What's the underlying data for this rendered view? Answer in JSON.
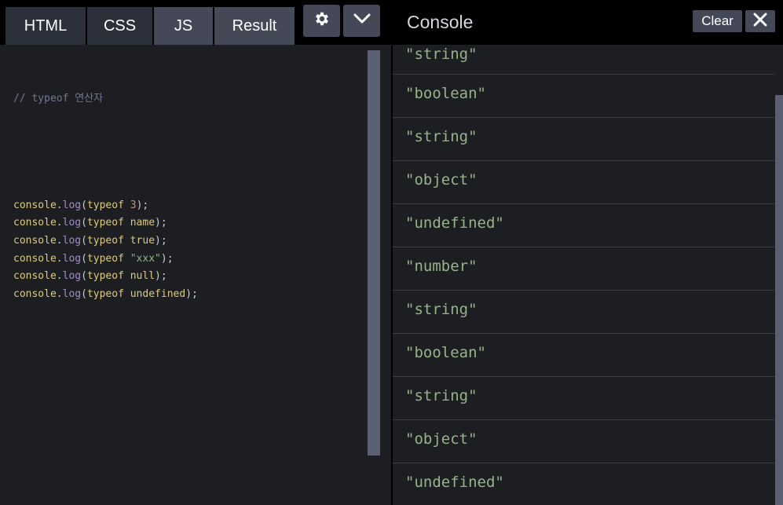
{
  "editor": {
    "tabs": [
      {
        "label": "HTML"
      },
      {
        "label": "CSS"
      },
      {
        "label": "JS"
      },
      {
        "label": "Result"
      }
    ],
    "settings_icon": "gear-icon",
    "collapse_icon": "chevron-down-icon",
    "code": {
      "comment": "// typeof 연산자",
      "lines": [
        {
          "obj": "console",
          "dot": ".",
          "method": "log",
          "open": "(",
          "kw": "typeof",
          "sp": " ",
          "arg": "3",
          "close": ");"
        },
        {
          "obj": "console",
          "dot": ".",
          "method": "log",
          "open": "(",
          "kw": "typeof",
          "sp": " ",
          "arg": "name",
          "close": ");"
        },
        {
          "obj": "console",
          "dot": ".",
          "method": "log",
          "open": "(",
          "kw": "typeof",
          "sp": " ",
          "arg": "true",
          "close": ");"
        },
        {
          "obj": "console",
          "dot": ".",
          "method": "log",
          "open": "(",
          "kw": "typeof",
          "sp": " ",
          "arg": "\"xxx\"",
          "close": ");"
        },
        {
          "obj": "console",
          "dot": ".",
          "method": "log",
          "open": "(",
          "kw": "typeof",
          "sp": " ",
          "arg": "null",
          "close": ");"
        },
        {
          "obj": "console",
          "dot": ".",
          "method": "log",
          "open": "(",
          "kw": "typeof",
          "sp": " ",
          "arg": "undefined",
          "close": ");"
        }
      ]
    }
  },
  "console": {
    "title": "Console",
    "clear_label": "Clear",
    "close_icon": "close-icon",
    "entries": [
      "\"string\"",
      "\"boolean\"",
      "\"string\"",
      "\"object\"",
      "\"undefined\"",
      "\"number\"",
      "\"string\"",
      "\"boolean\"",
      "\"string\"",
      "\"object\"",
      "\"undefined\""
    ]
  },
  "colors": {
    "string_output": "#96b38a",
    "active_tab": "#444857",
    "inactive_tab": "#2c303a",
    "background": "#1d1e22"
  }
}
